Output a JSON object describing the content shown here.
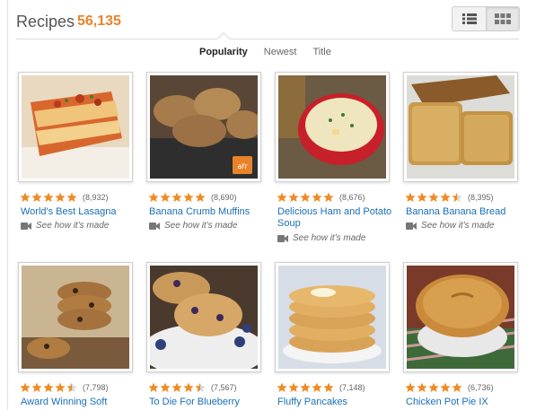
{
  "header": {
    "title": "Recipes",
    "count": "56,135"
  },
  "view_toggle": {
    "options": [
      "list-view",
      "grid-view"
    ],
    "active": "grid-view"
  },
  "sort": {
    "tabs": [
      "Popularity",
      "Newest",
      "Title"
    ],
    "active": "Popularity"
  },
  "colors": {
    "accent": "#e8832a",
    "link": "#1a6fb7",
    "star": "#f08a24"
  },
  "recipes": [
    {
      "name": "World's Best Lasagna",
      "rating": 5,
      "count": "(8,932)",
      "video": "See how it's made",
      "image": "lasagna"
    },
    {
      "name": "Banana Crumb Muffins",
      "rating": 5,
      "count": "(8,690)",
      "video": "See how it's made",
      "image": "muffins"
    },
    {
      "name": "Delicious Ham and Potato Soup",
      "rating": 5,
      "count": "(8,676)",
      "video": "See how it's made",
      "image": "soup"
    },
    {
      "name": "Banana Banana Bread",
      "rating": 4.5,
      "count": "(8,395)",
      "video": "See how it's made",
      "image": "bread"
    },
    {
      "name": "Award Winning Soft",
      "rating": 4.5,
      "count": "(7,798)",
      "video": "",
      "image": "cookies"
    },
    {
      "name": "To Die For Blueberry",
      "rating": 4.5,
      "count": "(7,567)",
      "video": "",
      "image": "blueberry-muffins"
    },
    {
      "name": "Fluffy Pancakes",
      "rating": 5,
      "count": "(7,148)",
      "video": "",
      "image": "pancakes"
    },
    {
      "name": "Chicken Pot Pie IX",
      "rating": 5,
      "count": "(6,736)",
      "video": "",
      "image": "pot-pie"
    }
  ]
}
